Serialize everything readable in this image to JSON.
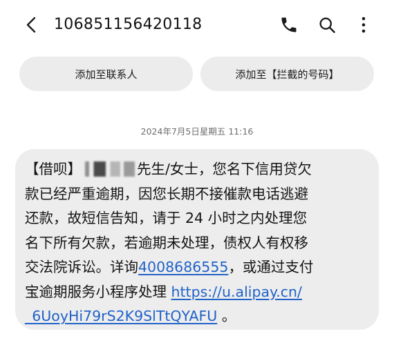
{
  "header": {
    "title": "10685115642011​8",
    "back_icon": "back-arrow-icon",
    "call_icon": "phone-icon",
    "search_icon": "search-icon",
    "more_icon": "more-vertical-icon"
  },
  "actions": {
    "add_contact": "添加至联系人",
    "add_blocked": "添加至【拦截的号码】"
  },
  "conversation": {
    "timestamp": "2024年7月5日星期五 11:16",
    "message": {
      "line1_prefix": "【借呗】",
      "line1_suffix": "先生/女士，您名下信用贷欠",
      "line2": "款已经严重逾期，因您长期不接催款电话逃避",
      "line3": "还款，故短信告知，请于 24 小时之内处理您",
      "line4": "名下所有欠款，若逾期未处理，债权人有权移",
      "line5_prefix": "交法院诉讼。详询",
      "phone_link": "4008686555",
      "line5_suffix": "，或通过支付",
      "line6_prefix": "宝逾期服务小程序处理 ",
      "url_part1": "https://u.alipay.cn/",
      "url_part2": "_6UoyHi79rS2K9SlTtQYAFU",
      "line7_suffix": " 。"
    }
  },
  "colors": {
    "link": "#1f62c9",
    "bubble": "#ededed",
    "pill": "#ececec"
  }
}
